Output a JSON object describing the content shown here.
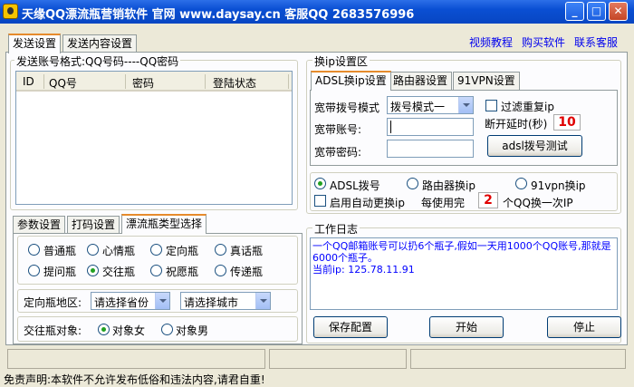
{
  "window": {
    "title": "天缘QQ漂流瓶营销软件 官网 www.daysay.cn 客服QQ 2683576996"
  },
  "top_tabs": [
    "发送设置",
    "发送内容设置"
  ],
  "top_links": [
    "视频教程",
    "购买软件",
    "联系客服"
  ],
  "account_group": {
    "label": "发送账号格式:QQ号码----QQ密码",
    "columns": [
      "ID",
      "QQ号",
      "密码",
      "登陆状态"
    ]
  },
  "ip_group": {
    "label": "换ip设置区",
    "tabs": [
      "ADSL换ip设置",
      "路由器设置",
      "91VPN设置"
    ],
    "dial_mode_label": "宽带拨号模式",
    "dial_mode_value": "拨号模式一",
    "filter_repeat_label": "过滤重复ip",
    "account_label": "宽带账号:",
    "password_label": "宽带密码:",
    "delay_label": "断开延时(秒)",
    "delay_value": "10",
    "test_button": "adsl拨号测试",
    "mode_options": [
      "ADSL拨号",
      "路由器换ip",
      "91vpn换ip"
    ],
    "auto_change_label": "启用自动更换ip",
    "every_label": "每使用完",
    "every_value": "2",
    "every_suffix": "个QQ换一次IP"
  },
  "bottle_tabs": [
    "参数设置",
    "打码设置",
    "漂流瓶类型选择"
  ],
  "bottle_types": [
    "普通瓶",
    "心情瓶",
    "定向瓶",
    "真话瓶",
    "提问瓶",
    "交往瓶",
    "祝愿瓶",
    "传递瓶"
  ],
  "bottle_selected": "交往瓶",
  "region": {
    "label": "定向瓶地区:",
    "province": "请选择省份",
    "city": "请选择城市"
  },
  "target": {
    "label": "交往瓶对象:",
    "options": [
      "对象女",
      "对象男"
    ],
    "selected": "对象女"
  },
  "log": {
    "label": "工作日志",
    "line1": "一个QQ邮箱账号可以扔6个瓶子,假如一天用1000个QQ账号,那就是6000个瓶子。",
    "line2": "当前ip: 125.78.11.91"
  },
  "buttons": {
    "save": "保存配置",
    "start": "开始",
    "stop": "停止"
  },
  "disclaimer": "免责声明:本软件不允许发布低俗和违法内容,请君自重!",
  "colors": {
    "title": "#0a4fd3",
    "log_text": "#0000ff",
    "red_value": "#e00000"
  }
}
